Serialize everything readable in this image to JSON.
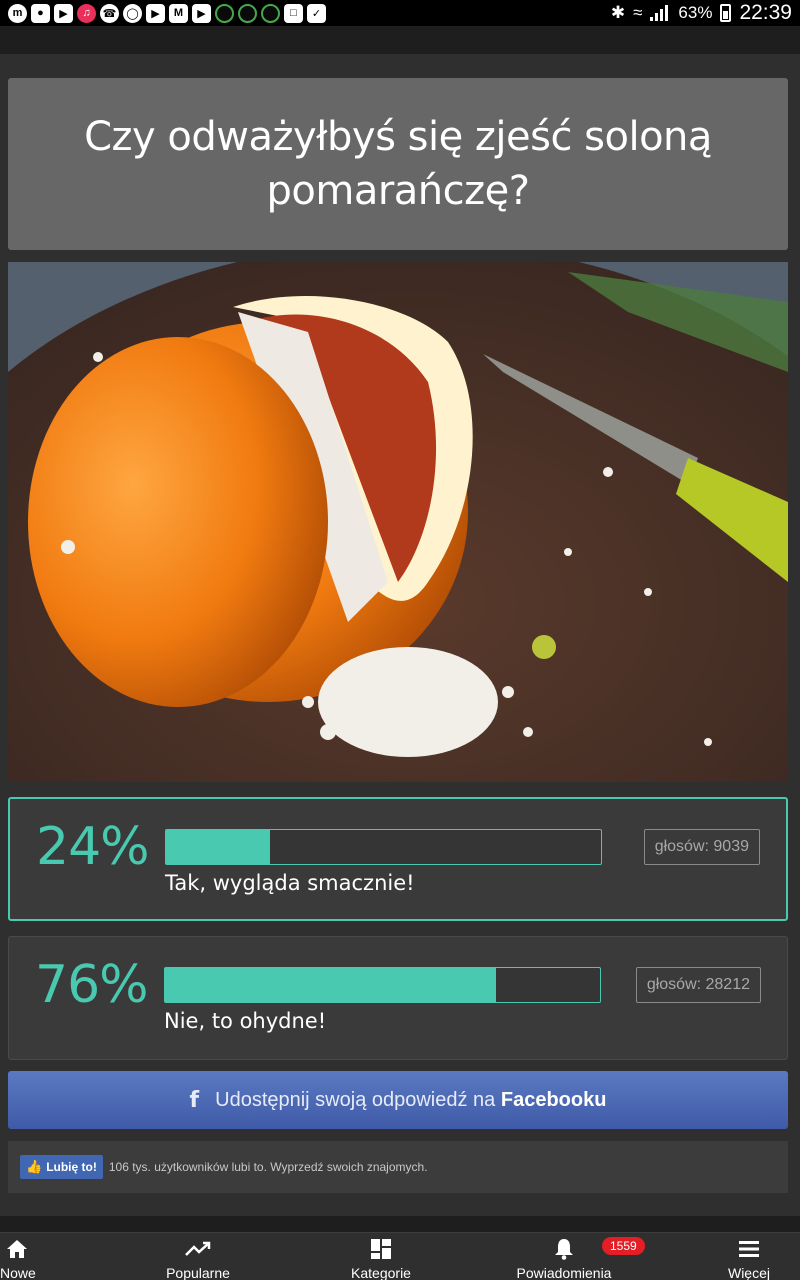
{
  "status_bar": {
    "left_icons": [
      "messenger-icon",
      "snapchat-icon",
      "youtube-icon",
      "music-app-icon",
      "whatsapp-icon",
      "chrome-icon",
      "youtube-icon",
      "gmail-icon",
      "youtube-icon",
      "game-icon",
      "game-icon",
      "game-icon",
      "gallery-icon",
      "check-icon"
    ],
    "battery": "63%",
    "time": "22:39"
  },
  "question": {
    "title": "Czy odważyłbyś się zjeść soloną pomarańczę?"
  },
  "photo": {
    "icon": "salted-orange-photo"
  },
  "answers": [
    {
      "percent": "24%",
      "fill_fraction": 0.24,
      "votes": "głosów: 9039",
      "label": "Tak, wygląda smacznie!",
      "selected": true
    },
    {
      "percent": "76%",
      "fill_fraction": 0.76,
      "votes": "głosów: 28212",
      "label": "Nie, to ohydne!",
      "selected": false
    }
  ],
  "facebook_share": {
    "icon": "facebook-icon",
    "text": "Udostępnij swoją odpowiedź na",
    "brand": "Facebooku"
  },
  "like_box": {
    "button_label": "Lubię to!",
    "text": "106 tys. użytkowników lubi to. Wyprzedź swoich znajomych."
  },
  "bottom_nav": {
    "items": [
      {
        "label": "Nowe",
        "icon": "home-icon"
      },
      {
        "label": "Popularne",
        "icon": "trending-icon"
      },
      {
        "label": "Kategorie",
        "icon": "grid-icon"
      },
      {
        "label": "Powiadomienia",
        "icon": "bell-icon"
      },
      {
        "label": "Więcej",
        "icon": "menu-icon"
      }
    ],
    "notification_count": "1559"
  },
  "colors": {
    "accent": "#48c9b0",
    "facebook": "#4267b2",
    "badge": "#e41e26"
  }
}
